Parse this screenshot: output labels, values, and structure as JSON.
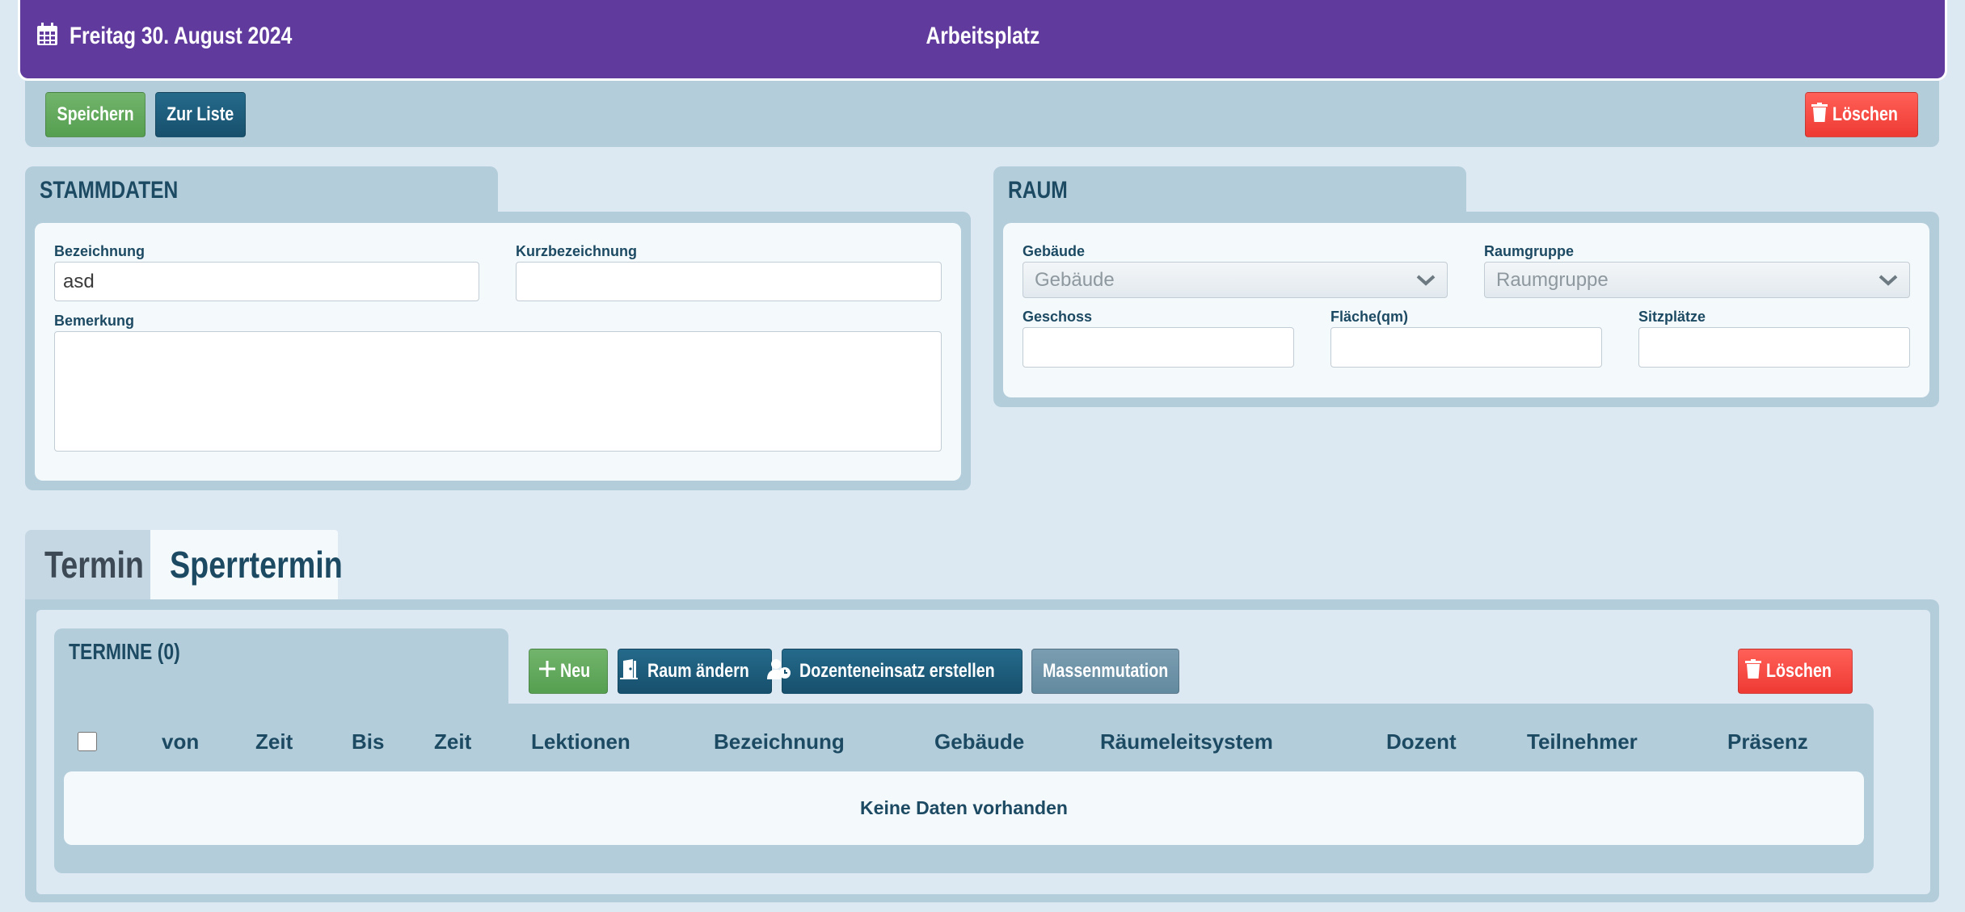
{
  "header": {
    "date": "Freitag 30. August 2024",
    "title": "Arbeitsplatz",
    "calendar_icon": "calendar-icon"
  },
  "toolbar": {
    "save_label": "Speichern",
    "list_label": "Zur Liste",
    "delete_label": "Löschen"
  },
  "stammdaten": {
    "title": "STAMMDATEN",
    "bezeichnung_label": "Bezeichnung",
    "bezeichnung_value": "asd",
    "kurz_label": "Kurzbezeichnung",
    "kurz_value": "",
    "bemerkung_label": "Bemerkung",
    "bemerkung_value": ""
  },
  "raum": {
    "title": "RAUM",
    "gebaeude_label": "Gebäude",
    "gebaeude_value": "Gebäude",
    "raumgruppe_label": "Raumgruppe",
    "raumgruppe_value": "Raumgruppe",
    "geschoss_label": "Geschoss",
    "flaeche_label": "Fläche(qm)",
    "sitzplaetze_label": "Sitzplätze"
  },
  "tabs": [
    {
      "label": "Termin",
      "active": false
    },
    {
      "label": "Sperrtermin",
      "active": true
    }
  ],
  "termine": {
    "title": "TERMINE (0)",
    "new_label": "Neu",
    "raum_label": "Raum ändern",
    "dozent_label": "Dozenteneinsatz erstellen",
    "mass_label": "Massenmutation",
    "delete_label": "Löschen",
    "columns": [
      "von",
      "Zeit",
      "Bis",
      "Zeit",
      "Lektionen",
      "Bezeichnung",
      "Gebäude",
      "Räumeleitsystem",
      "Dozent",
      "Teilnehmer",
      "Präsenz"
    ],
    "empty_text": "Keine Daten vorhanden"
  },
  "colors": {
    "header_bg": "#603a9c",
    "panel_bg": "#b3cdda",
    "page_bg": "#dde9f2",
    "text": "#1d4a63",
    "green": "#5ea858",
    "navy": "#1d5c7b",
    "red": "#f34a43"
  }
}
